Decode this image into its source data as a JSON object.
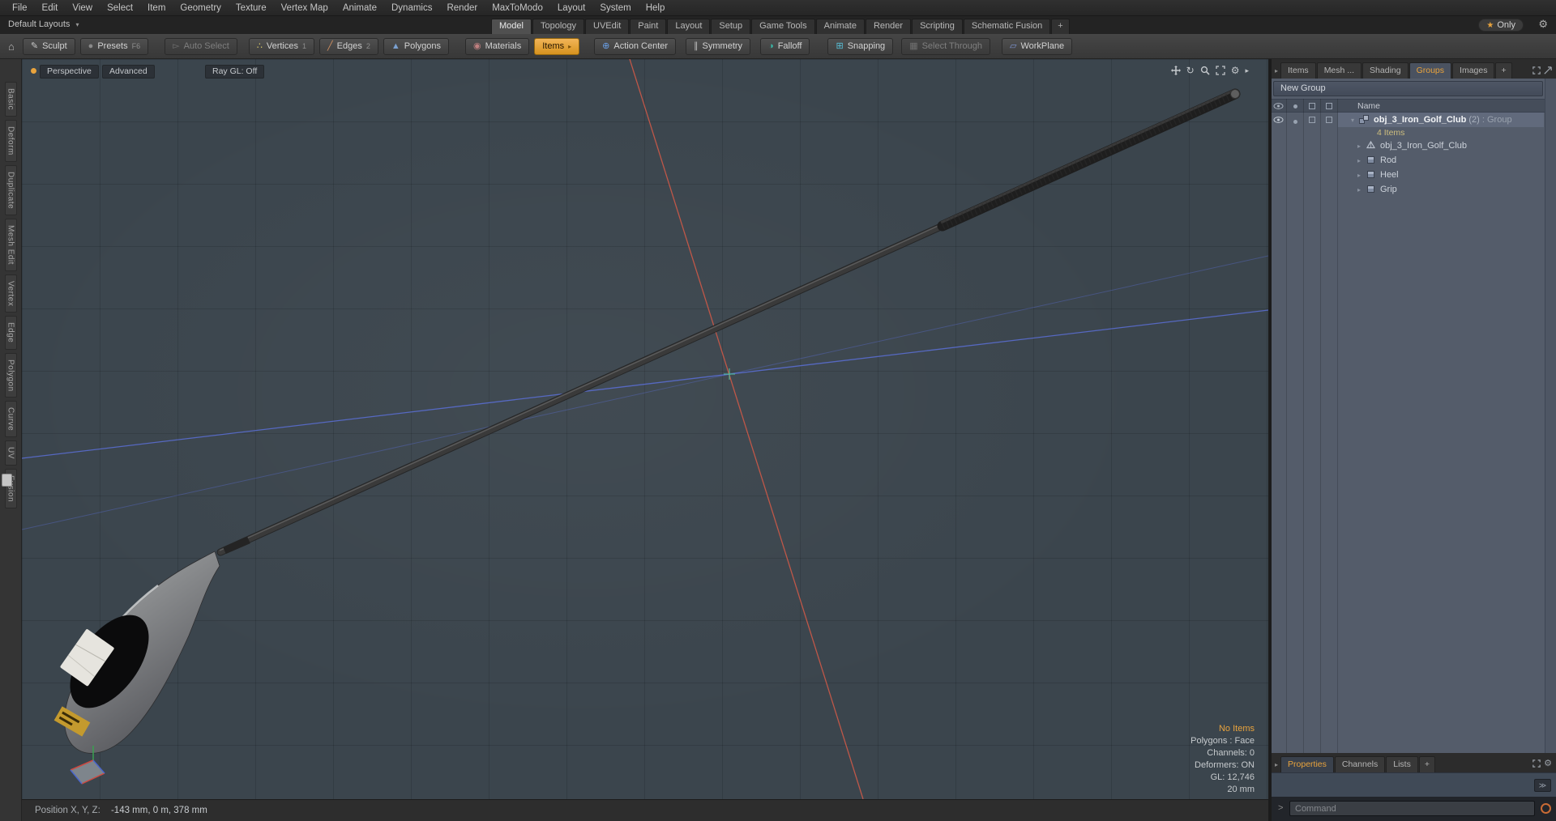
{
  "icons": {
    "caret_down": "▾",
    "caret_right": "▸",
    "star": "★",
    "gear": "⚙",
    "home": "⌂",
    "brush": "✎",
    "sphere": "●",
    "vertices": "∴",
    "edge": "╱",
    "polygon": "▲",
    "material": "◉",
    "action_center": "⊕",
    "symmetry": "∥",
    "falloff": "◑",
    "snapping": "⊞",
    "select_through": "▦",
    "workplane": "▱",
    "orbit": "↻",
    "chevrons": "≫",
    "prompt": ">",
    "auto_select": "▻"
  },
  "menu_bar": {
    "items": [
      "File",
      "Edit",
      "View",
      "Select",
      "Item",
      "Geometry",
      "Texture",
      "Vertex Map",
      "Animate",
      "Dynamics",
      "Render",
      "MaxToModo",
      "Layout",
      "System",
      "Help"
    ]
  },
  "layout_bar": {
    "default_layouts": "Default Layouts",
    "tabs": [
      "Model",
      "Topology",
      "UVEdit",
      "Paint",
      "Layout",
      "Setup",
      "Game Tools",
      "Animate",
      "Render",
      "Scripting",
      "Schematic Fusion",
      "+"
    ],
    "active_tab": "Model",
    "only": "Only"
  },
  "toolbar": {
    "sculpt": "Sculpt",
    "presets": "Presets",
    "presets_key": "F6",
    "auto_select": "Auto Select",
    "vertices": "Vertices",
    "vertices_key": "1",
    "edges": "Edges",
    "edges_key": "2",
    "polygons": "Polygons",
    "materials": "Materials",
    "items": "Items",
    "action_center": "Action Center",
    "symmetry": "Symmetry",
    "falloff": "Falloff",
    "snapping": "Snapping",
    "select_through": "Select Through",
    "workplane": "WorkPlane"
  },
  "left_tabs": [
    "Basic",
    "Deform",
    "Duplicate",
    "Mesh Edit",
    "Vertex",
    "Edge",
    "Polygon",
    "Curve",
    "UV",
    "Fusion"
  ],
  "viewport": {
    "perspective": "Perspective",
    "advanced": "Advanced",
    "raygl": "Ray GL: Off",
    "info": [
      "No Items",
      "Polygons : Face",
      "Channels: 0",
      "Deformers: ON",
      "GL: 12,746",
      "20 mm"
    ]
  },
  "right_panel": {
    "tabs": [
      "Items",
      "Mesh ...",
      "Shading",
      "Groups",
      "Images",
      "+"
    ],
    "active_tab": "Groups",
    "new_group": "New Group",
    "name_header": "Name",
    "group": {
      "label": "obj_3_Iron_Golf_Club",
      "count": "(2)",
      "type": ": Group"
    },
    "items_count": "4 Items",
    "children": [
      "obj_3_Iron_Golf_Club",
      "Rod",
      "Heel",
      "Grip"
    ]
  },
  "bottom_panel": {
    "tabs": [
      "Properties",
      "Channels",
      "Lists",
      "+"
    ],
    "active_tab": "Properties",
    "command_placeholder": "Command"
  },
  "status_bar": {
    "label": "Position X, Y, Z:",
    "value": "-143 mm, 0 m, 378 mm"
  },
  "colors": {
    "accent": "#e8a33d",
    "axis_red": "#c65848",
    "axis_blue": "#5b6fd6",
    "viewport_bg": "#3b454d"
  }
}
